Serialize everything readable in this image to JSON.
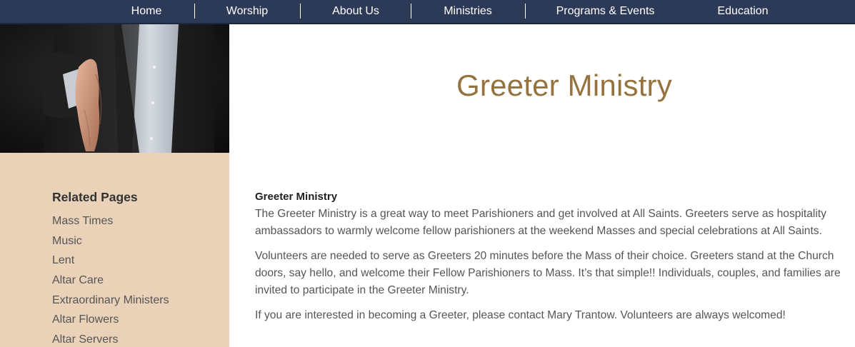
{
  "nav": {
    "items": [
      "Home",
      "Worship",
      "About Us",
      "Ministries",
      "Programs & Events",
      "Education"
    ]
  },
  "sidebar": {
    "title": "Related Pages",
    "links": [
      "Mass Times",
      "Music",
      "Lent",
      "Altar Care",
      "Extraordinary Ministers",
      "Altar Flowers",
      "Altar Servers"
    ]
  },
  "page": {
    "title": "Greeter Ministry"
  },
  "content": {
    "heading": "Greeter Ministry",
    "paragraphs": [
      "The Greeter Ministry is a great way to meet Parishioners and get involved at All Saints. Greeters serve as hospitality ambassadors to warmly welcome fellow parishioners at the weekend Masses and special celebrations at All Saints.",
      "Volunteers are needed to serve as Greeters 20 minutes before the Mass of their choice. Greeters stand at the Church doors, say hello, and welcome their Fellow Parishioners to Mass. It’s that simple!! Individuals, couples, and families are invited to participate in the Greeter Ministry.",
      "If you are interested in becoming a Greeter, please contact Mary Trantow. Volunteers are always welcomed!"
    ]
  },
  "colors": {
    "nav_bg": "#2c3957",
    "sidebar_bg": "#ead2b9",
    "title": "#94733f"
  }
}
